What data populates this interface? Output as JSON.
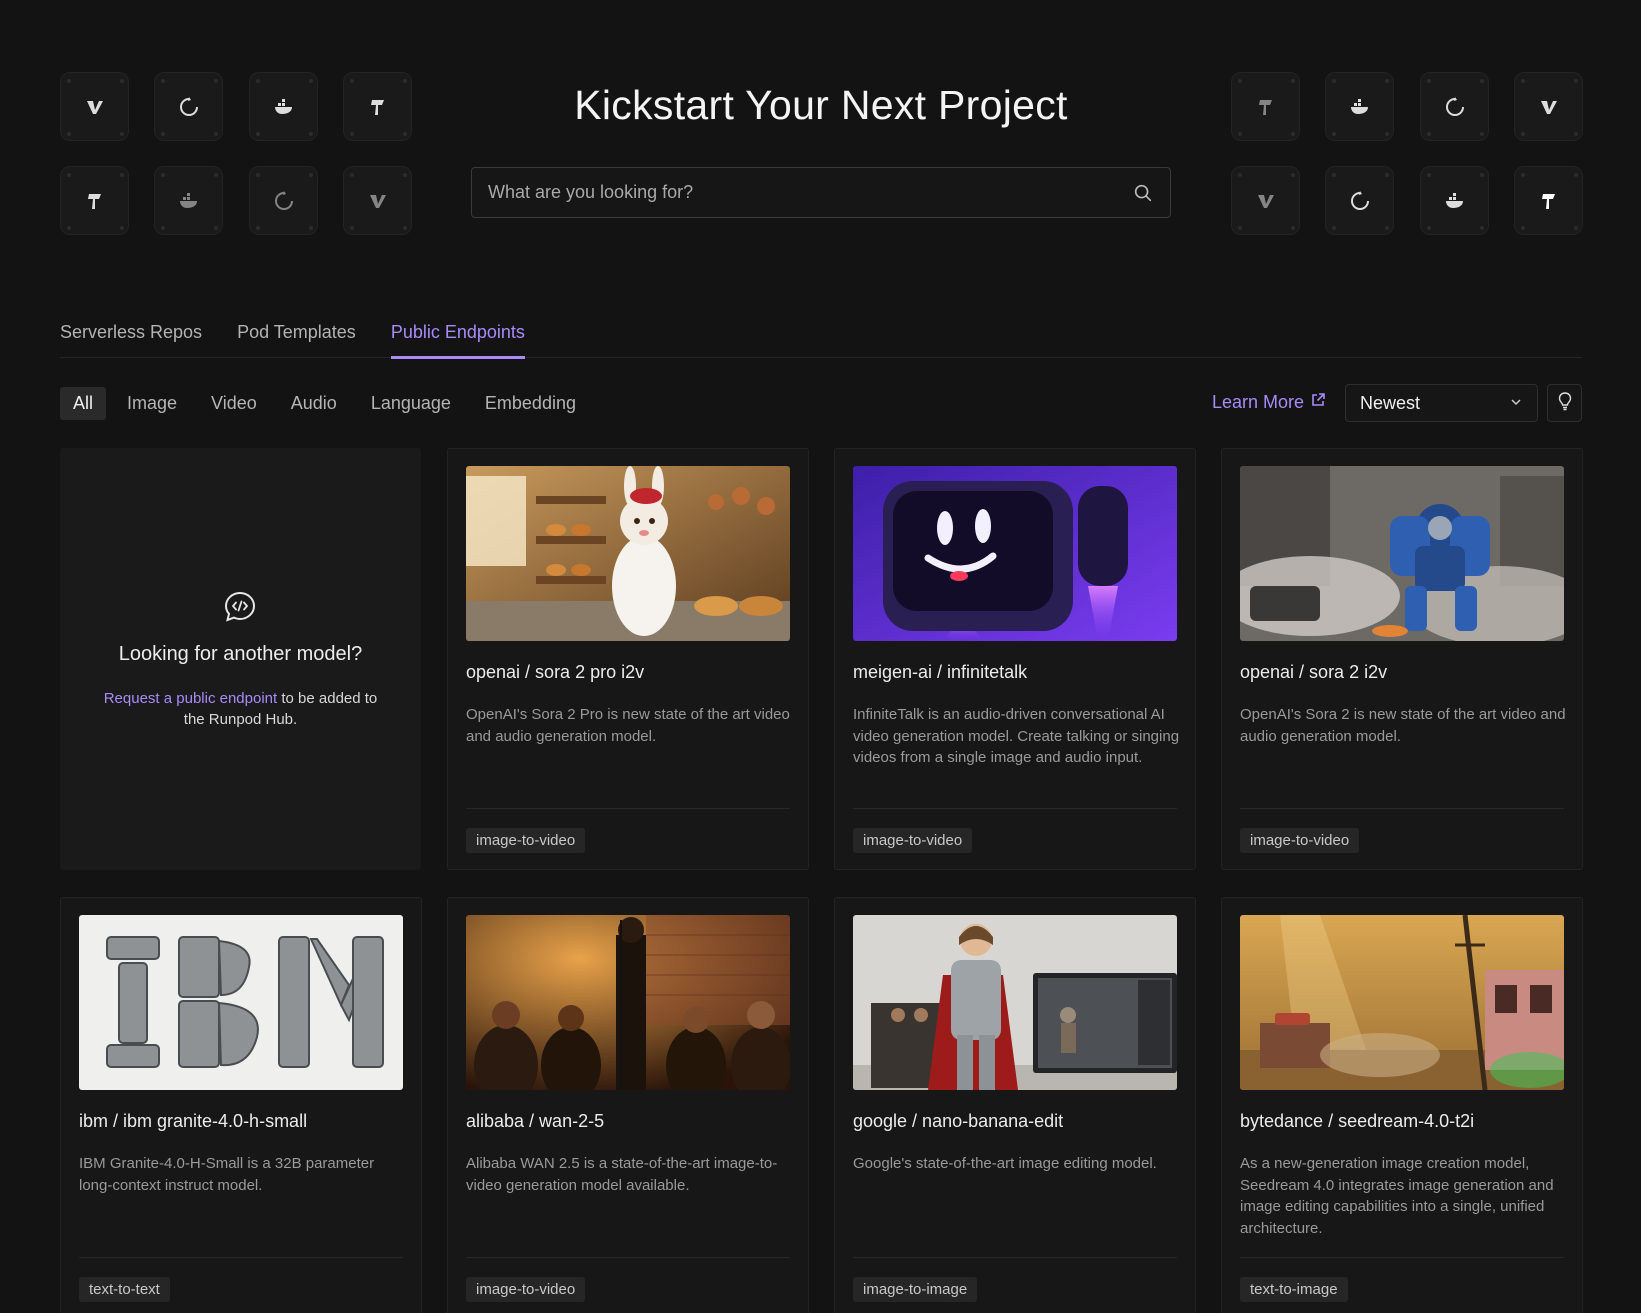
{
  "hero": {
    "title": "Kickstart Your Next Project",
    "search_placeholder": "What are you looking for?"
  },
  "tabs": [
    {
      "label": "Serverless Repos",
      "active": false
    },
    {
      "label": "Pod Templates",
      "active": false
    },
    {
      "label": "Public Endpoints",
      "active": true
    }
  ],
  "filters": [
    {
      "label": "All",
      "active": true
    },
    {
      "label": "Image",
      "active": false
    },
    {
      "label": "Video",
      "active": false
    },
    {
      "label": "Audio",
      "active": false
    },
    {
      "label": "Language",
      "active": false
    },
    {
      "label": "Embedding",
      "active": false
    }
  ],
  "toolbar": {
    "learn_more": "Learn More",
    "sort_value": "Newest"
  },
  "request_card": {
    "question": "Looking for another model?",
    "link_text": "Request a public endpoint",
    "suffix": " to be added to the Runpod Hub."
  },
  "cards": [
    {
      "title": "openai / sora 2 pro i2v",
      "description": "OpenAI's Sora 2 Pro is new state of the art video and audio generation model.",
      "tag": "image-to-video",
      "image": "bunny-chef-bakery"
    },
    {
      "title": "meigen-ai / infinitetalk",
      "description": "InfiniteTalk is an audio-driven conversational AI video generation model. Create talking or singing videos from a single image and audio input.",
      "tag": "image-to-video",
      "image": "robot-mascot"
    },
    {
      "title": "openai / sora 2 i2v",
      "description": "OpenAI's Sora 2 is new state of the art video and audio generation model.",
      "tag": "image-to-video",
      "image": "battle-mech"
    },
    {
      "title": "ibm / ibm granite-4.0-h-small",
      "description": "IBM Granite-4.0-H-Small is a 32B parameter long-context instruct model.",
      "tag": "text-to-text",
      "image": "ibm-stone-letters"
    },
    {
      "title": "alibaba / wan-2-5",
      "description": "Alibaba WAN 2.5 is a state-of-the-art image-to-video generation model available.",
      "tag": "image-to-video",
      "image": "comedy-club"
    },
    {
      "title": "google / nano-banana-edit",
      "description": "Google's state-of-the-art image editing model.",
      "tag": "image-to-image",
      "image": "knight-figure"
    },
    {
      "title": "bytedance / seedream-4.0-t2i",
      "description": "As a new-generation image creation model, Seedream 4.0 integrates image generation and image editing capabilities into a single, unified architecture.",
      "tag": "text-to-image",
      "image": "desert-town"
    }
  ],
  "colors": {
    "background": "#131313",
    "accent": "#a78bfa",
    "card": "#171717"
  }
}
